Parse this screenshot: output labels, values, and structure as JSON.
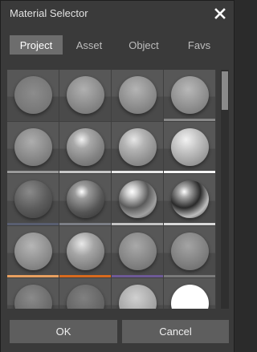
{
  "window": {
    "title": "Material Selector",
    "close_icon": "close-icon"
  },
  "tabs": [
    {
      "label": "Project",
      "active": true
    },
    {
      "label": "Asset",
      "active": false
    },
    {
      "label": "Object",
      "active": false
    },
    {
      "label": "Favs",
      "active": false
    }
  ],
  "materials": [
    {
      "style": "radial-gradient(circle at 50% 45%, #8c8c8c 0%, #7a7a7a 60%, #6a6a6a 100%)",
      "stripe": "",
      "selected": true
    },
    {
      "style": "radial-gradient(circle at 45% 35%, #b0b0b0 0%, #8a8a8a 55%, #6b6b6b 100%)",
      "stripe": "",
      "selected": false
    },
    {
      "style": "radial-gradient(circle at 45% 35%, #b4b4b4 0%, #8d8d8d 55%, #6d6d6d 100%)",
      "stripe": "",
      "selected": false
    },
    {
      "style": "radial-gradient(circle at 45% 35%, #b8b8b8 0%, #909090 55%, #6e6e6e 100%)",
      "stripe": "#888888",
      "selected": false
    },
    {
      "style": "radial-gradient(circle at 45% 35%, #adadad 0%, #878787 55%, #686868 100%)",
      "stripe": "#9a9a9a",
      "selected": false
    },
    {
      "style": "radial-gradient(circle at 40% 30%, #f0f0f0 0%, #a8a8a8 25%, #838383 60%, #626262 100%)",
      "stripe": "#c8c8c8",
      "selected": false
    },
    {
      "style": "radial-gradient(circle at 40% 30%, #e6e6e6 0%, #b3b3b3 30%, #8f8f8f 65%, #707070 100%)",
      "stripe": "#e8e8e8",
      "selected": false
    },
    {
      "style": "radial-gradient(circle at 40% 30%, #f2f2f2 0%, #c4c4c4 35%, #9c9c9c 70%, #7a7a7a 100%)",
      "stripe": "#f5f5f5",
      "selected": false
    },
    {
      "style": "radial-gradient(circle at 40% 30%, #8a8a8a 0%, #5c5c5c 50%, #3a3a3a 100%)",
      "stripe": "#595e70",
      "selected": false
    },
    {
      "style": "radial-gradient(circle at 40% 30%, #ffffff 0%, #9a9a9a 20%, #555555 60%, #2e2e2e 100%)",
      "stripe": "#7c7f86",
      "selected": false
    },
    {
      "style": "radial-gradient(circle at 35% 30%, #ffffff 0%, #d0d0d0 15%, #5a5a5a 45%, #a0a0a0 70%, #303030 100%)",
      "stripe": "#c4c4c4",
      "selected": false
    },
    {
      "style": "radial-gradient(circle at 35% 30%, #ffffff 0%, #a8a8a8 15%, #2a2a2a 45%, #bdbdbd 70%, #1f1f1f 100%)",
      "stripe": "#d9d9d9",
      "selected": false
    },
    {
      "style": "radial-gradient(circle at 45% 35%, #b6b6b6 0%, #8e8e8e 55%, #6c6c6c 100%)",
      "stripe": "#e8a060",
      "selected": false
    },
    {
      "style": "radial-gradient(circle at 40% 30%, #e8e8e8 0%, #a4a4a4 35%, #818181 70%, #626262 100%)",
      "stripe": "#d86a1e",
      "selected": false
    },
    {
      "style": "radial-gradient(circle at 45% 35%, #a9a9a9 0%, #858585 55%, #666666 100%)",
      "stripe": "#6e5a96",
      "selected": false
    },
    {
      "style": "radial-gradient(circle at 45% 35%, #a4a4a4 0%, #818181 55%, #636363 100%)",
      "stripe": "#7a7a7a",
      "selected": false
    },
    {
      "style": "radial-gradient(circle at 45% 35%, #8a8a8a 0%, #6e6e6e 55%, #585858 100%)",
      "stripe": "",
      "selected": false
    },
    {
      "style": "radial-gradient(circle at 45% 35%, #808080 0%, #676767 55%, #545454 100%)",
      "stripe": "",
      "selected": false
    },
    {
      "style": "radial-gradient(circle at 45% 35%, #d0d0d0 0%, #a8a8a8 55%, #868686 100%)",
      "stripe": "",
      "selected": false
    },
    {
      "style": "radial-gradient(circle at 50% 50%, #ffffff 0%, #ffffff 70%, #e6e6e6 100%)",
      "stripe": "",
      "selected": false
    }
  ],
  "buttons": {
    "ok": "OK",
    "cancel": "Cancel"
  }
}
